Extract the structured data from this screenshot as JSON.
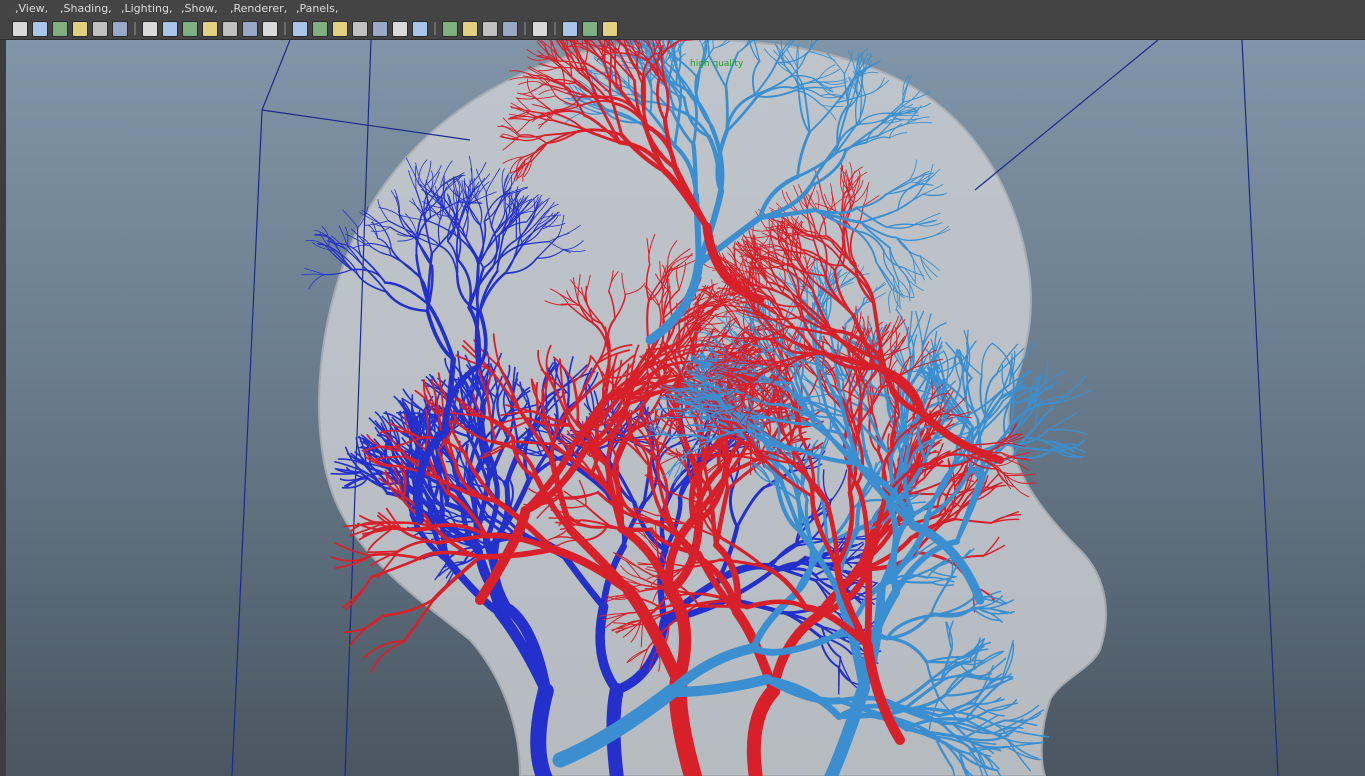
{
  "menubar": {
    "items": [
      {
        "label": ",View,"
      },
      {
        "label": ",Shading,"
      },
      {
        "label": ",Lighting,"
      },
      {
        "label": ",Show,"
      },
      {
        "label": ",Renderer,"
      },
      {
        "label": ",Panels,"
      }
    ]
  },
  "toolbar": {
    "icons": [
      "select-camera-icon",
      "camera-attributes-icon",
      "bookmark-icon",
      "image-plane-icon",
      "2d-pan-zoom-icon",
      "grease-pencil-icon",
      "separator",
      "grid-icon",
      "film-gate-icon",
      "resolution-gate-icon",
      "gate-mask-icon",
      "field-chart-icon",
      "safe-action-icon",
      "safe-title-icon",
      "separator",
      "wireframe-icon",
      "smooth-shade-icon",
      "wireframe-on-shaded-icon",
      "textured-icon",
      "use-default-light-icon",
      "shadows-icon",
      "ambient-occlusion-icon",
      "separator",
      "motion-blur-icon",
      "anti-aliasing-icon",
      "depth-of-field-icon",
      "xray-icon",
      "separator",
      "isolate-select-icon",
      "separator",
      "xray-joints-icon",
      "xray-components-icon",
      "share-icon"
    ]
  },
  "viewport": {
    "label": "high quality",
    "colors": {
      "artery": "#d8202a",
      "vein_dark": "#2430cc",
      "vein_light": "#3b8fd0",
      "head": "#c9cdd1",
      "wire": "#1c2a8a"
    }
  }
}
